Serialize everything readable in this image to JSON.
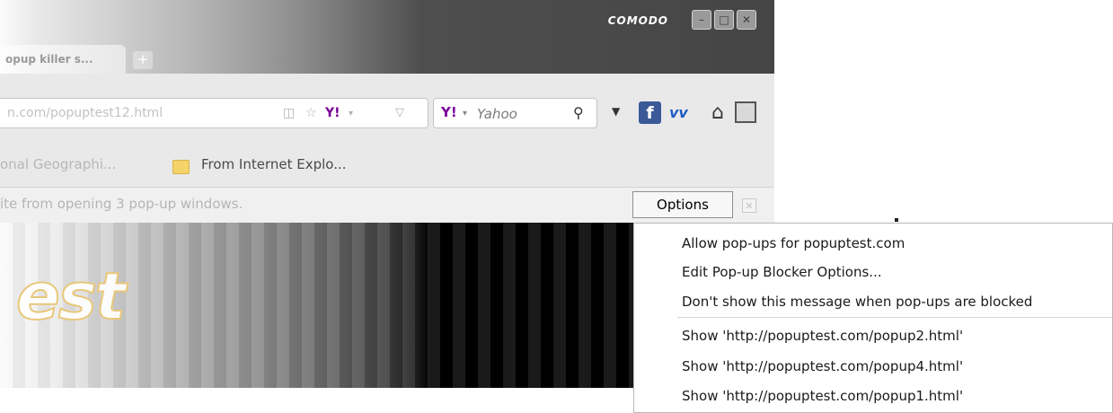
{
  "window": {
    "brand": "COMODO",
    "controls": {
      "minimize": "–",
      "maximize": "□",
      "close": "✕"
    }
  },
  "tabs": [
    {
      "label": "opup killer s..."
    }
  ],
  "new_tab_label": "+",
  "address_bar": {
    "url": "n.com/popuptest12.html"
  },
  "search": {
    "badge": "Y!",
    "engine": "Yahoo"
  },
  "bookmarks": [
    {
      "label": "onal Geographi..."
    },
    {
      "label": "From Internet Explo..."
    }
  ],
  "notification": {
    "text": "ite from opening 3 pop-up windows.",
    "options_button": "Options",
    "close_label": "✕"
  },
  "page_logo_text": "est",
  "options_menu": {
    "items": [
      {
        "label": "Allow pop-ups for popuptest.com"
      },
      {
        "label": "Edit Pop-up Blocker Options..."
      },
      {
        "label": "Don't show this message when pop-ups are blocked"
      }
    ],
    "popups": [
      {
        "label": "Show 'http://popuptest.com/popup2.html'"
      },
      {
        "label": "Show 'http://popuptest.com/popup4.html'"
      },
      {
        "label": "Show 'http://popuptest.com/popup1.html'"
      }
    ]
  },
  "colors": {
    "titlebar_dark": "#454545",
    "facebook": "#3b5998",
    "yahoo_purple": "#7b0099",
    "notification_bg": "#f0f0f0"
  },
  "icons": [
    "reader-icon",
    "star-icon",
    "yahoo-icon",
    "search-icon",
    "facebook-icon",
    "vw-icon",
    "home-icon",
    "square-icon",
    "folder-icon",
    "close-icon"
  ]
}
